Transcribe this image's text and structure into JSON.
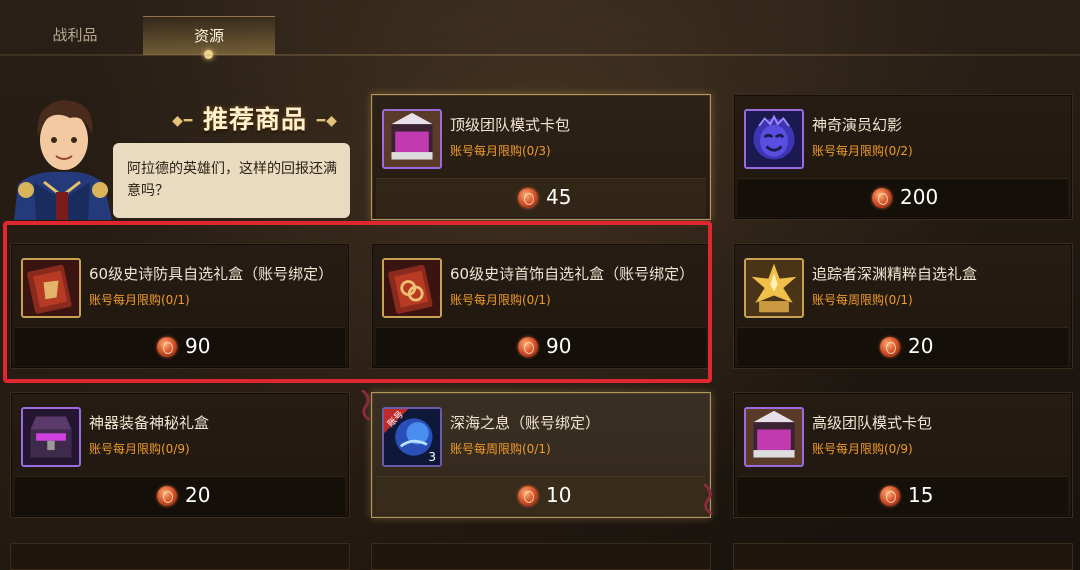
{
  "tabs": [
    {
      "label": "战利品",
      "active": false
    },
    {
      "label": "资源",
      "active": true
    }
  ],
  "promo": {
    "title": "推荐商品",
    "speech": "阿拉德的英雄们，这样的回报还满意吗？"
  },
  "currency_icon": "orange-coin-icon",
  "items": [
    {
      "name": "顶级团队模式卡包",
      "limit": "账号每月限购(0/3)",
      "price": "45",
      "icon": "purple-card-pack-icon",
      "highlighted": true
    },
    {
      "name": "神奇演员幻影",
      "limit": "账号每月限购(0/2)",
      "price": "200",
      "icon": "masked-phantom-icon",
      "highlighted": false
    },
    {
      "name": "60级史诗防具自选礼盒（账号绑定）",
      "limit": "账号每月限购(0/1)",
      "price": "90",
      "icon": "armor-giftbox-icon",
      "highlighted": false
    },
    {
      "name": "60级史诗首饰自选礼盒（账号绑定）",
      "limit": "账号每月限购(0/1)",
      "price": "90",
      "icon": "jewelry-giftbox-icon",
      "highlighted": false
    },
    {
      "name": "追踪者深渊精粹自选礼盒",
      "limit": "账号每周限购(0/1)",
      "price": "20",
      "icon": "abyss-essence-box-icon",
      "highlighted": false
    },
    {
      "name": "神器装备神秘礼盒",
      "limit": "账号每月限购(0/9)",
      "price": "20",
      "icon": "mystery-chest-icon",
      "highlighted": false
    },
    {
      "name": "深海之息（账号绑定）",
      "limit": "账号每周限购(0/1)",
      "price": "10",
      "icon": "deep-sea-orb-icon",
      "highlighted": true,
      "badge": "账号",
      "count": "3"
    },
    {
      "name": "高级团队模式卡包",
      "limit": "账号每月限购(0/9)",
      "price": "15",
      "icon": "purple-card-pack-icon",
      "highlighted": false
    }
  ],
  "colors": {
    "limit_text": "#ef9a2e",
    "highlight_border": "#b39459",
    "selection_box": "#e0262e"
  }
}
